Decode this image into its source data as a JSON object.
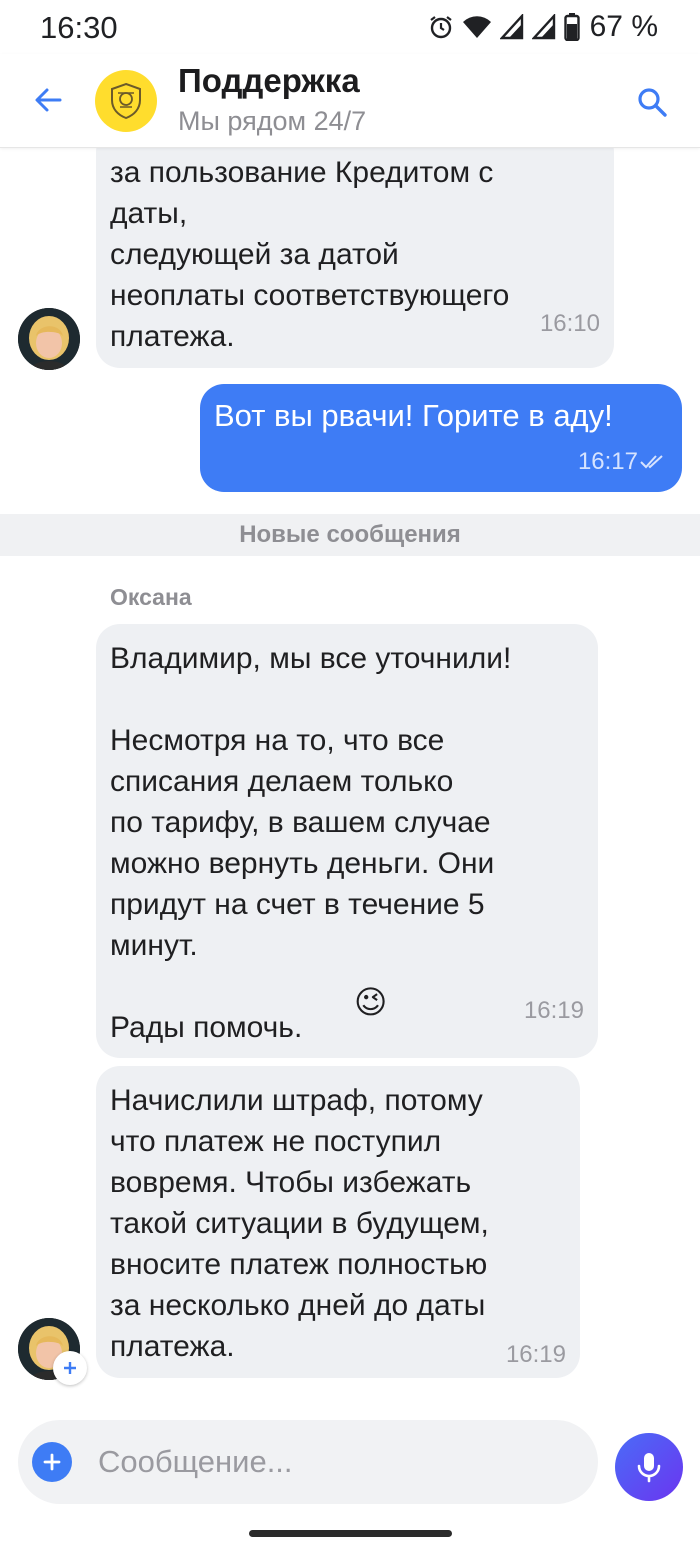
{
  "status_bar": {
    "time": "16:30",
    "battery": "67 %",
    "icons": [
      "alarm-icon",
      "wifi-icon",
      "signal-icon",
      "signal-icon",
      "battery-icon"
    ]
  },
  "header": {
    "title": "Поддержка",
    "subtitle": "Мы рядом 24/7",
    "logo_color": "#ffdd2d"
  },
  "messages": {
    "m1": {
      "text": "за пользование Кредитом с\nдаты,\nследующей за датой\nнеоплаты соответствующего\nплатежа.",
      "time": "16:10"
    },
    "m2": {
      "text": "Вот вы рвачи! Горите в аду!",
      "time": "16:17"
    },
    "divider": "Новые сообщения",
    "sender": "Оксана",
    "m3": {
      "text": "Владимир, мы все уточнили!\n\nНесмотря на то, что все\nсписания делаем только\nпо тарифу, в вашем случае\nможно вернуть деньги. Они\nпридут на счет в течение 5\nминут.\n\nРады помочь.",
      "emoji": "😉",
      "time": "16:19"
    },
    "m4": {
      "text": "Начислили штраф, потому\nчто платеж не поступил\nвовремя. Чтобы избежать\nтакой ситуации в будущем,\nвносите платеж полностью\nза несколько дней до даты\nплатежа.",
      "time": "16:19"
    }
  },
  "composer": {
    "placeholder": "Сообщение..."
  },
  "colors": {
    "accent": "#3e7cf5",
    "bubble_in": "#eef0f3",
    "mic_gradient": [
      "#4a6cf7",
      "#6b35f0"
    ]
  }
}
